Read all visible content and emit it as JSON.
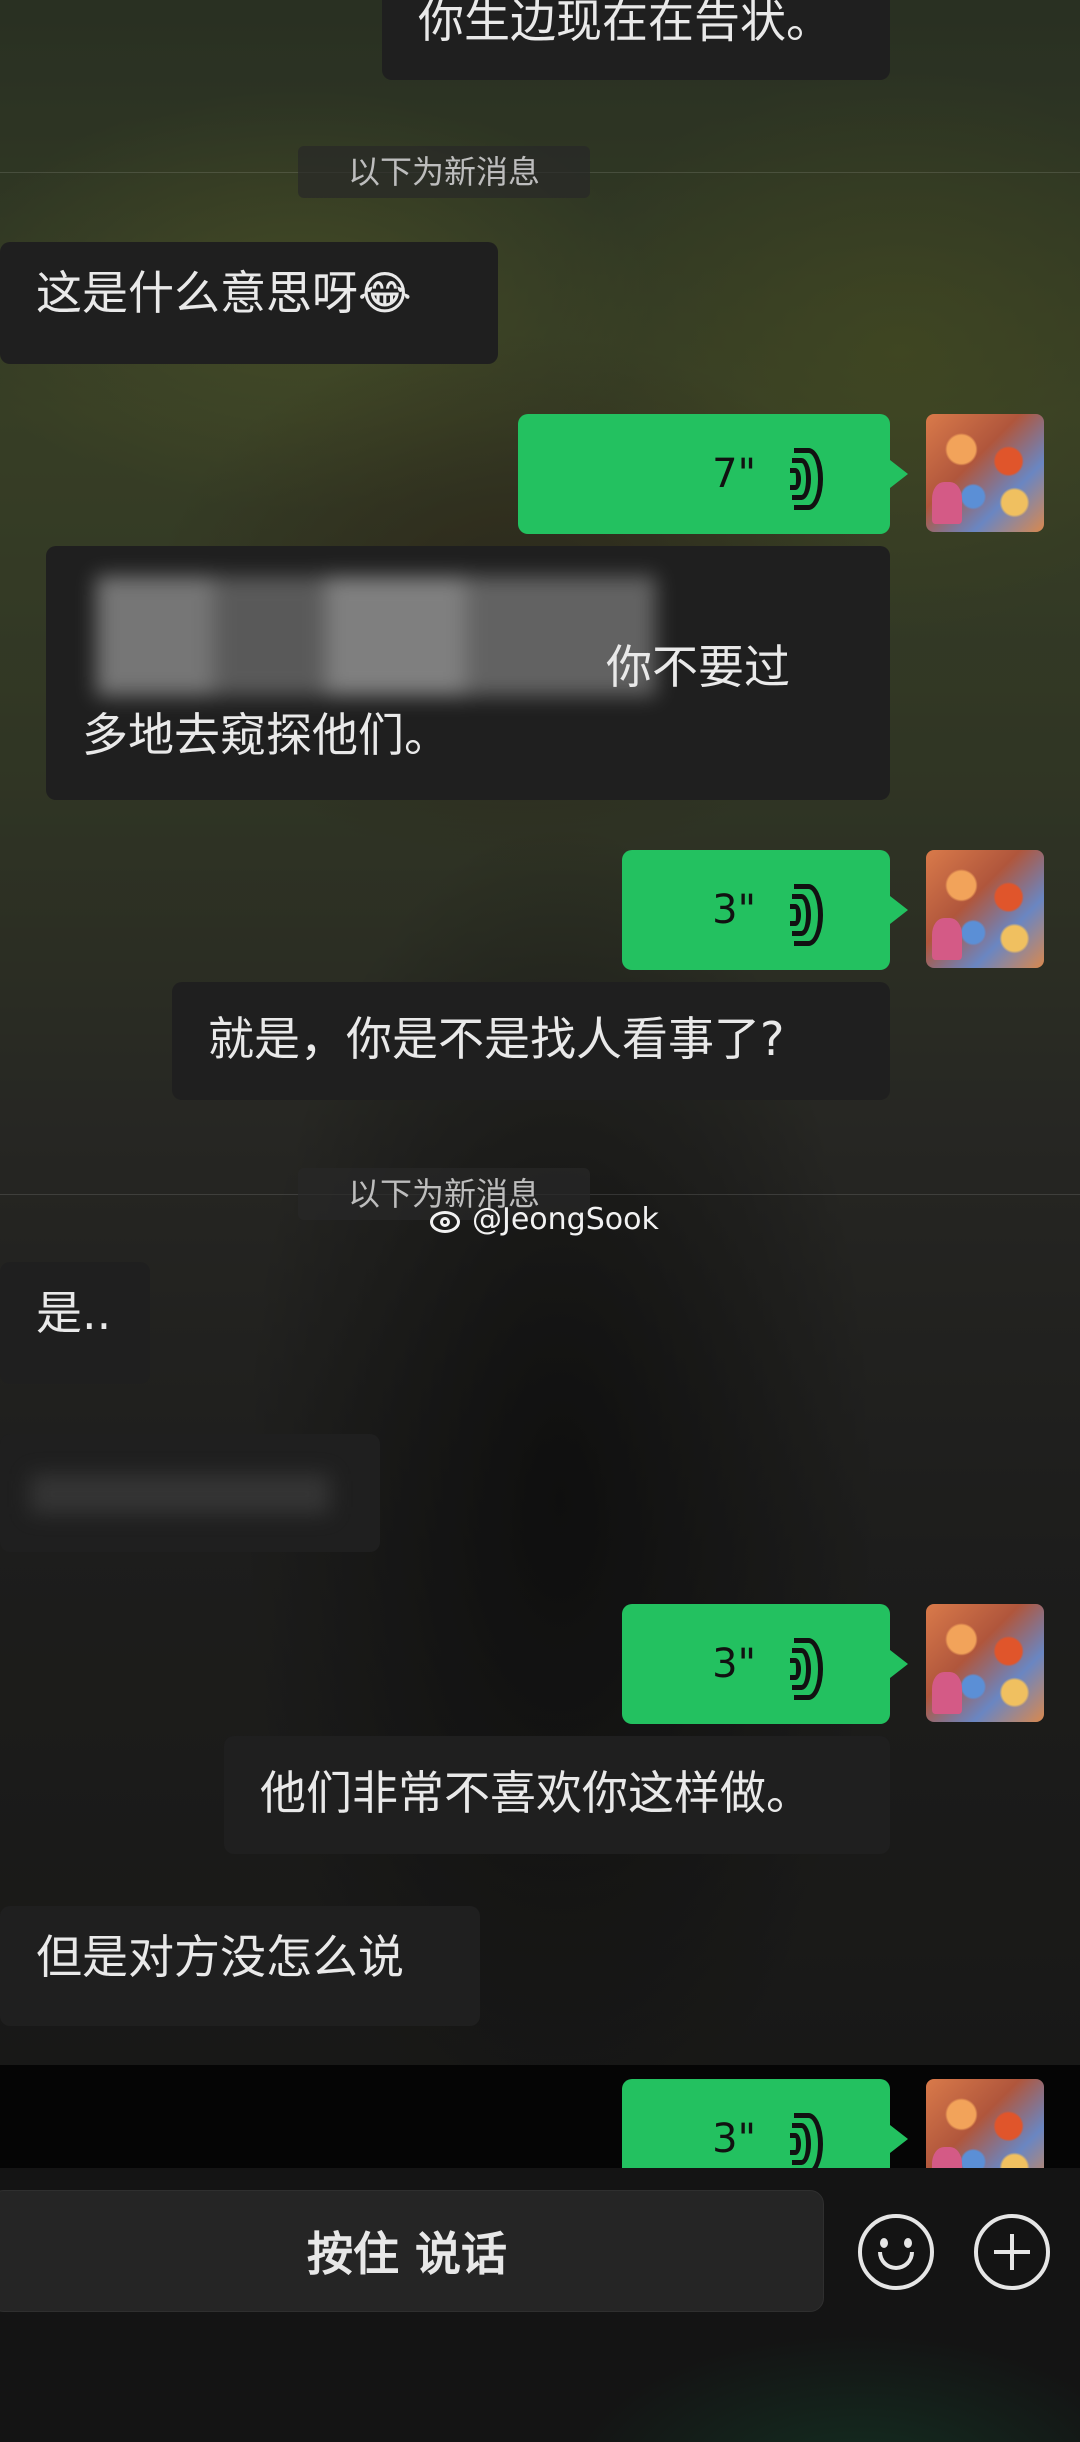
{
  "chat": {
    "top_partial": "你生边现在在告状。",
    "new_messages_divider_1": "以下为新消息",
    "msg_1": "这是什么意思呀😂",
    "voice_1": "7\"",
    "msg_2_line1": "你不要过",
    "msg_2_line2": "多地去窥探他们。",
    "voice_2": "3\"",
    "msg_3": "就是，你是不是找人看事了?",
    "new_messages_divider_2": "以下为新消息",
    "msg_4": "是..",
    "voice_3": "3\"",
    "msg_5": "他们非常不喜欢你这样做。",
    "msg_6": "但是对方没怎么说",
    "voice_4": "3\""
  },
  "watermark": {
    "text": "@JeongSook"
  },
  "input_bar": {
    "talk_label": "按住 说话"
  },
  "colors": {
    "voice_bubble": "#23c160",
    "bubble_dark": "#1f1f1f",
    "background": "#0b0b0b"
  },
  "icons": {
    "emoji": "smiley-icon",
    "more": "plus-icon",
    "voice": "voice-wave-icon",
    "watermark": "weibo-icon"
  }
}
